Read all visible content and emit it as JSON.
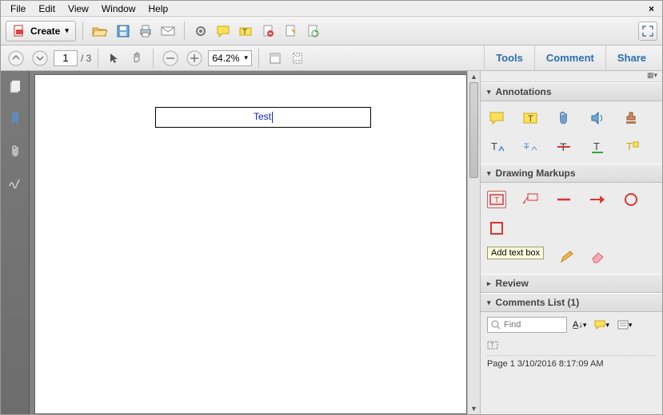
{
  "menubar": {
    "items": [
      "File",
      "Edit",
      "View",
      "Window",
      "Help"
    ]
  },
  "toolbar1": {
    "create_label": "Create"
  },
  "toolbar2": {
    "page_current": "1",
    "page_total": "/ 3",
    "zoom_value": "64.2%"
  },
  "right_tabs": {
    "tools": "Tools",
    "comment": "Comment",
    "share": "Share"
  },
  "document": {
    "textbox_value": "Test"
  },
  "panel": {
    "annotations_title": "Annotations",
    "drawing_title": "Drawing Markups",
    "review_title": "Review",
    "comments_title": "Comments List (1)",
    "tooltip_add_textbox": "Add text box",
    "find_placeholder": "Find",
    "comment_line": "Page 1  3/10/2016 8:17:09 AM"
  }
}
